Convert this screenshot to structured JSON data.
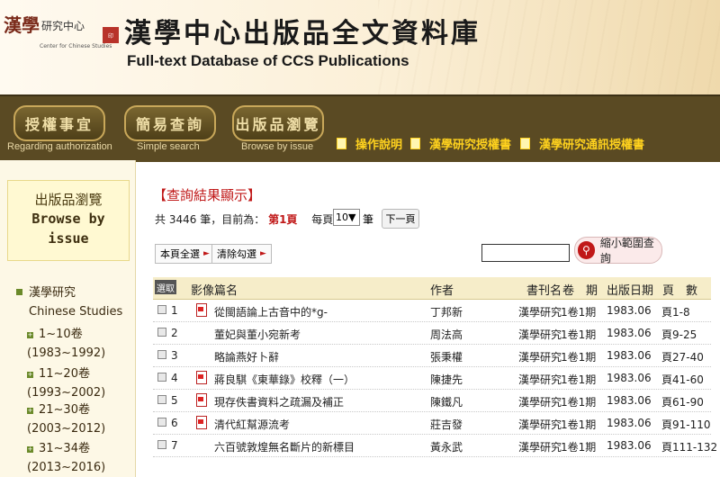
{
  "header": {
    "logo_han": "漢學",
    "logo_center": "研究中心",
    "logo_en": "Center for Chinese Studies",
    "title_zh": "漢學中心出版品全文資料庫",
    "title_en": "Full-text Database of CCS Publications"
  },
  "nav": {
    "buttons": [
      {
        "label": "授權事宜",
        "sub": "Regarding authorization"
      },
      {
        "label": "簡易查詢",
        "sub": "Simple search"
      },
      {
        "label": "出版品瀏覽",
        "sub": "Browse by issue"
      }
    ],
    "links": [
      "操作說明",
      "漢學研究授權書",
      "漢學研究通訊授權書"
    ]
  },
  "sidebar": {
    "head_zh": "出版品瀏覽",
    "head_en_1": "Browse by",
    "head_en_2": "issue",
    "root_zh": "漢學研究",
    "root_en": "Chinese Studies",
    "groups": [
      {
        "label": "1~10卷",
        "range": "(1983~1992)"
      },
      {
        "label": "11~20卷",
        "range": "(1993~2002)"
      },
      {
        "label": "21~30卷",
        "range": "(2003~2012)"
      },
      {
        "label": "31~34卷",
        "range": "(2013~2016)"
      }
    ]
  },
  "results": {
    "title": "【查詢結果顯示】",
    "summary_prefix": "共",
    "total": "3446",
    "summary_mid": "筆，目前為：",
    "current_page": "第1頁",
    "per_page_label": "每頁顯示",
    "per_page": "10▼",
    "per_page_unit": "筆",
    "next": "下一頁",
    "select_all": "本頁全選",
    "clear": "清除勾選",
    "search_btn": "縮小範圍查詢",
    "columns": {
      "select": "選取",
      "image": "影像",
      "title": "篇名",
      "author": "作者",
      "journal": "書刊名",
      "issue": "卷　期",
      "date": "出版日期",
      "pages": "頁　數"
    },
    "rows": [
      {
        "n": "1",
        "pdf": true,
        "title": "從閩語論上古音中的*g-",
        "author": "丁邦新",
        "journal": "漢學研究",
        "issue": "1卷1期",
        "date": "1983.06",
        "pages": "頁1-8"
      },
      {
        "n": "2",
        "pdf": false,
        "title": "董妃與董小宛新考",
        "author": "周法高",
        "journal": "漢學研究",
        "issue": "1卷1期",
        "date": "1983.06",
        "pages": "頁9-25"
      },
      {
        "n": "3",
        "pdf": false,
        "title": "略論燕好卜辭",
        "author": "張秉權",
        "journal": "漢學研究",
        "issue": "1卷1期",
        "date": "1983.06",
        "pages": "頁27-40"
      },
      {
        "n": "4",
        "pdf": true,
        "title": "蔣良騏《東華錄》校釋（一）",
        "author": "陳捷先",
        "journal": "漢學研究",
        "issue": "1卷1期",
        "date": "1983.06",
        "pages": "頁41-60"
      },
      {
        "n": "5",
        "pdf": true,
        "title": "現存佚書資料之疏漏及補正",
        "author": "陳鐵凡",
        "journal": "漢學研究",
        "issue": "1卷1期",
        "date": "1983.06",
        "pages": "頁61-90"
      },
      {
        "n": "6",
        "pdf": true,
        "title": "清代紅幫源流考",
        "author": "莊吉發",
        "journal": "漢學研究",
        "issue": "1卷1期",
        "date": "1983.06",
        "pages": "頁91-110"
      },
      {
        "n": "7",
        "pdf": false,
        "title": "六百號敦煌無名斷片的新標目",
        "author": "黃永武",
        "journal": "漢學研究",
        "issue": "1卷1期",
        "date": "1983.06",
        "pages": "頁111-132"
      }
    ]
  }
}
